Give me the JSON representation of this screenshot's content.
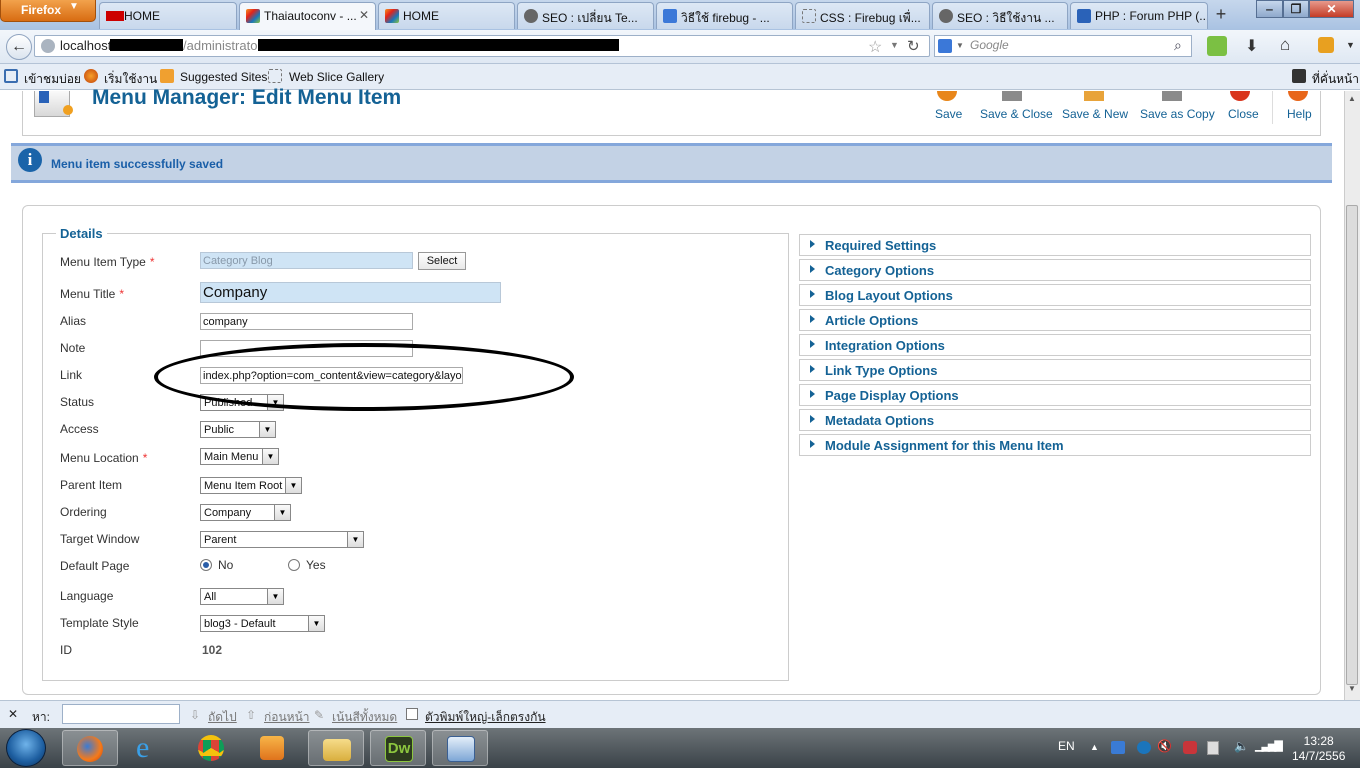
{
  "browser": {
    "app_button": "Firefox",
    "tabs": [
      {
        "label": "HOME",
        "active": false
      },
      {
        "label": "Thaiautoconv - ...",
        "active": true
      },
      {
        "label": "HOME",
        "active": false
      },
      {
        "label": "SEO : เปลี่ยน Te...",
        "active": false
      },
      {
        "label": "วิธีใช้ firebug - ...",
        "active": false
      },
      {
        "label": "CSS : Firebug เพื่...",
        "active": false
      },
      {
        "label": "SEO : วิธีใช้งาน ...",
        "active": false
      },
      {
        "label": "PHP : Forum PHP (...",
        "active": false
      }
    ],
    "url_host": "localhost/",
    "url_path": "/administrator",
    "search_placeholder": "Google",
    "bookmarks": [
      {
        "label": "เข้าชมบ่อย"
      },
      {
        "label": "เริ่มใช้งาน"
      },
      {
        "label": "Suggested Sites"
      },
      {
        "label": "Web Slice Gallery"
      }
    ],
    "bookmarks_right": "ที่คั่นหน้า"
  },
  "page": {
    "title": "Menu Manager: Edit Menu Item",
    "toolbar": [
      {
        "label": "Save",
        "color": "#e8861a"
      },
      {
        "label": "Save & Close",
        "color": "#8a8a8a"
      },
      {
        "label": "Save & New",
        "color": "#e8a33a"
      },
      {
        "label": "Save as Copy",
        "color": "#8a8a8a"
      },
      {
        "label": "Close",
        "color": "#d9351c"
      },
      {
        "label": "Help",
        "color": "#e8661a"
      }
    ],
    "message": "Menu item successfully saved",
    "details_legend": "Details",
    "fields": {
      "menu_item_type": {
        "label": "Menu Item Type",
        "value": "Category Blog",
        "button": "Select"
      },
      "menu_title": {
        "label": "Menu Title",
        "value": "Company"
      },
      "alias": {
        "label": "Alias",
        "value": "company"
      },
      "note": {
        "label": "Note",
        "value": ""
      },
      "link": {
        "label": "Link",
        "value": "index.php?option=com_content&view=category&layout="
      },
      "status": {
        "label": "Status",
        "value": "Published"
      },
      "access": {
        "label": "Access",
        "value": "Public"
      },
      "menu_location": {
        "label": "Menu Location",
        "value": "Main Menu"
      },
      "parent_item": {
        "label": "Parent Item",
        "value": "Menu Item Root"
      },
      "ordering": {
        "label": "Ordering",
        "value": "Company"
      },
      "target_window": {
        "label": "Target Window",
        "value": "Parent"
      },
      "default_page": {
        "label": "Default Page",
        "opt_no": "No",
        "opt_yes": "Yes",
        "selected": "No"
      },
      "language": {
        "label": "Language",
        "value": "All"
      },
      "template_style": {
        "label": "Template Style",
        "value": "blog3 - Default"
      },
      "id": {
        "label": "ID",
        "value": "102"
      }
    },
    "required_mark": "*",
    "accordion": [
      "Required Settings",
      "Category Options",
      "Blog Layout Options",
      "Article Options",
      "Integration Options",
      "Link Type Options",
      "Page Display Options",
      "Metadata Options",
      "Module Assignment for this Menu Item"
    ]
  },
  "findbar": {
    "label": "หา:",
    "next": "ถัดไป",
    "prev": "ก่อนหน้า",
    "highlight": "เน้นสีทั้งหมด",
    "match_case": "ตัวพิมพ์ใหญ่-เล็กตรงกัน"
  },
  "taskbar": {
    "lang": "EN",
    "time": "13:28",
    "date": "14/7/2556"
  },
  "colors": {
    "accent": "#146295",
    "message_bg": "#c3d2e5",
    "required": "#ee3333"
  }
}
